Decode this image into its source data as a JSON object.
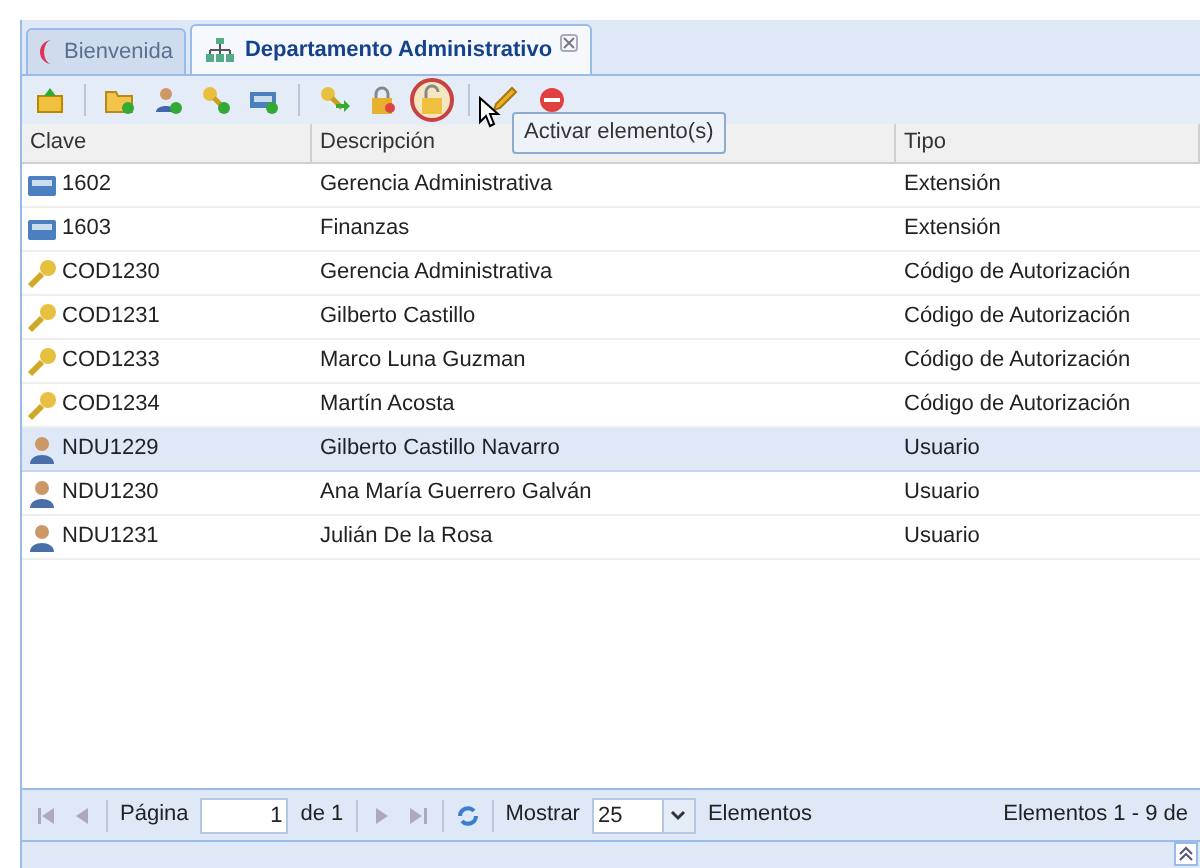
{
  "tabs": [
    {
      "label": "Bienvenida",
      "kind": "welcome",
      "selected": false,
      "closable": false
    },
    {
      "label": "Departamento Administrativo",
      "kind": "org",
      "selected": true,
      "closable": true
    }
  ],
  "toolbar": [
    {
      "kind": "upload",
      "highlighted": false
    },
    {
      "kind": "sep"
    },
    {
      "kind": "folder-add",
      "highlighted": false
    },
    {
      "kind": "user-add",
      "highlighted": false
    },
    {
      "kind": "key-add",
      "highlighted": false
    },
    {
      "kind": "phone-add",
      "highlighted": false
    },
    {
      "kind": "sep"
    },
    {
      "kind": "key-go",
      "highlighted": false
    },
    {
      "kind": "lock",
      "highlighted": false
    },
    {
      "kind": "unlock",
      "highlighted": true
    },
    {
      "kind": "sep"
    },
    {
      "kind": "pencil",
      "highlighted": false
    },
    {
      "kind": "delete",
      "highlighted": false
    }
  ],
  "tooltip": "Activar elemento(s)",
  "table": {
    "columns": [
      "Clave",
      "Descripción",
      "Tipo"
    ],
    "rows": [
      {
        "kind": "phone",
        "clave": "1602",
        "descripcion": "Gerencia Administrativa",
        "tipo": "Extensión",
        "selected": false
      },
      {
        "kind": "phone",
        "clave": "1603",
        "descripcion": "Finanzas",
        "tipo": "Extensión",
        "selected": false
      },
      {
        "kind": "key",
        "clave": "COD1230",
        "descripcion": "Gerencia Administrativa",
        "tipo": "Código de Autorización",
        "selected": false
      },
      {
        "kind": "key",
        "clave": "COD1231",
        "descripcion": "Gilberto Castillo",
        "tipo": "Código de Autorización",
        "selected": false
      },
      {
        "kind": "key",
        "clave": "COD1233",
        "descripcion": "Marco Luna Guzman",
        "tipo": "Código de Autorización",
        "selected": false
      },
      {
        "kind": "key",
        "clave": "COD1234",
        "descripcion": "Martín Acosta",
        "tipo": "Código de Autorización",
        "selected": false
      },
      {
        "kind": "user",
        "clave": "NDU1229",
        "descripcion": "Gilberto Castillo Navarro",
        "tipo": "Usuario",
        "selected": true
      },
      {
        "kind": "user",
        "clave": "NDU1230",
        "descripcion": "Ana María Guerrero Galván",
        "tipo": "Usuario",
        "selected": false
      },
      {
        "kind": "user",
        "clave": "NDU1231",
        "descripcion": "Julián De la Rosa",
        "tipo": "Usuario",
        "selected": false
      }
    ]
  },
  "pager": {
    "page_label": "Página",
    "page": "1",
    "of": "de 1",
    "show_label": "Mostrar",
    "page_size": "25",
    "items_label": "Elementos",
    "summary": "Elementos 1 - 9 de"
  }
}
